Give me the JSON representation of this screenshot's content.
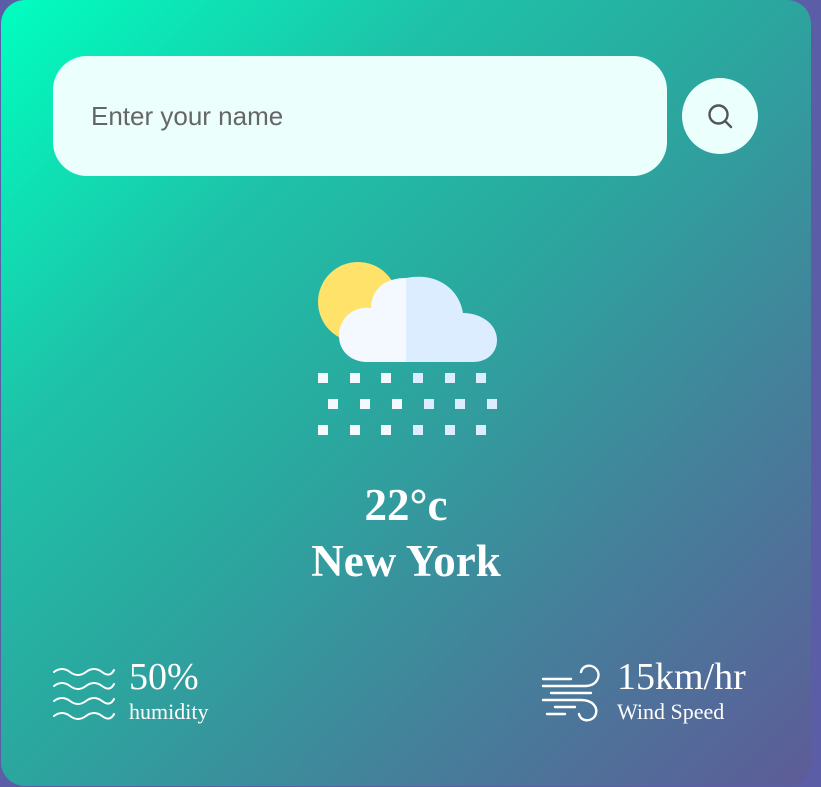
{
  "search": {
    "placeholder": "Enter your name",
    "icon": "search-icon"
  },
  "weather": {
    "icon": "cloud-sun-snow-icon",
    "temperature": "22°c",
    "city": "New York"
  },
  "humidity": {
    "icon": "humidity-waves-icon",
    "value": "50%",
    "label": "humidity"
  },
  "wind": {
    "icon": "wind-icon",
    "value": "15km/hr",
    "label": "Wind Speed"
  },
  "colors": {
    "gradient_start": "#00ffc0",
    "gradient_end": "#5e5b98",
    "field_background": "#ebfffc",
    "sun": "#ffe26a",
    "cloud_light": "#f4f9ff",
    "cloud_shade": "#dcedff"
  }
}
